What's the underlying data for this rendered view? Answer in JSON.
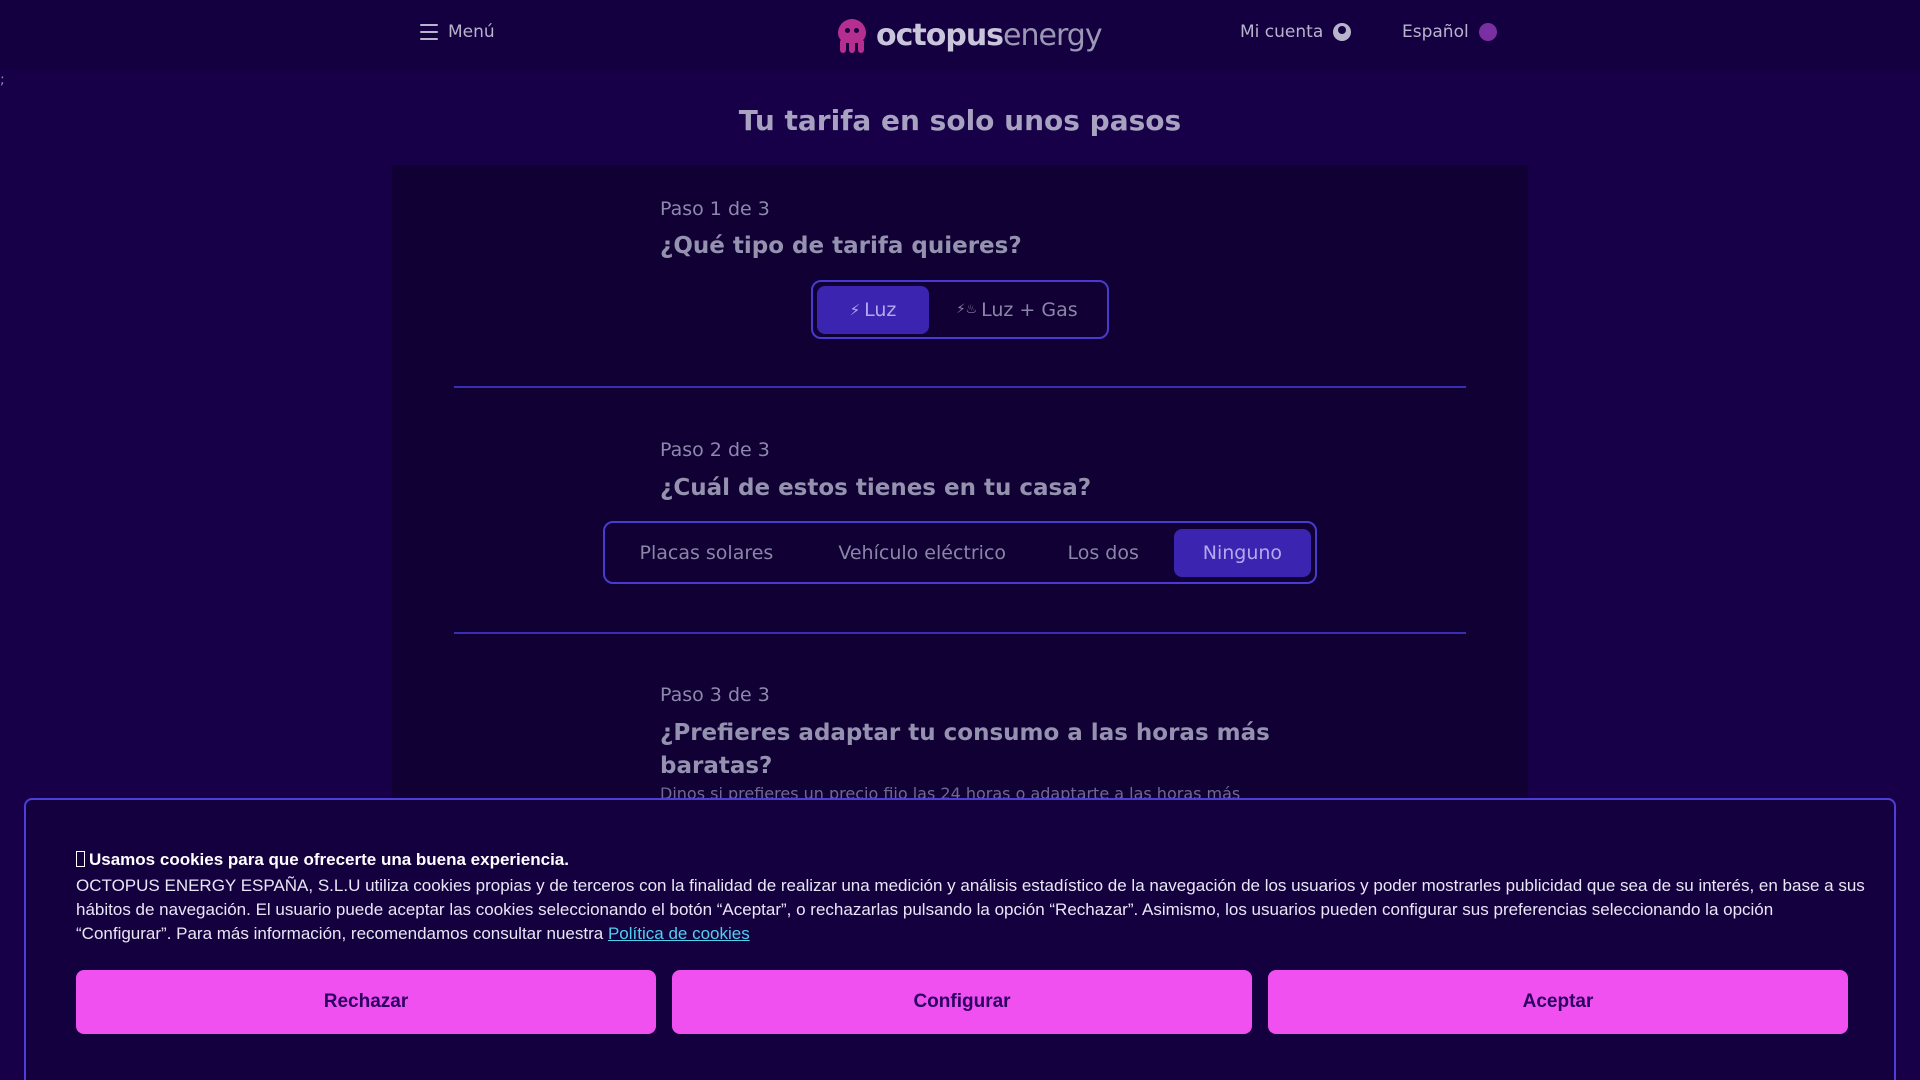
{
  "header": {
    "menu_label": "Menú",
    "logo_text_bold": "octopus",
    "logo_text_light": "energy",
    "account_label": "Mi cuenta",
    "language_label": "Español"
  },
  "stray_text": ";",
  "page": {
    "title": "Tu tarifa en solo unos pasos"
  },
  "steps": [
    {
      "label": "Paso 1 de 3",
      "question": "¿Qué tipo de tarifa quieres?",
      "options": [
        {
          "label": "Luz",
          "icon": "bolt-icon",
          "selected": true
        },
        {
          "label": "Luz + Gas",
          "icon": "bolt-flame-icon",
          "selected": false
        }
      ]
    },
    {
      "label": "Paso 2 de 3",
      "question": "¿Cuál de estos tienes en tu casa?",
      "options": [
        {
          "label": "Placas solares",
          "selected": false
        },
        {
          "label": "Vehículo eléctrico",
          "selected": false
        },
        {
          "label": "Los dos",
          "selected": false
        },
        {
          "label": "Ninguno",
          "selected": true
        }
      ]
    },
    {
      "label": "Paso 3 de 3",
      "question_line1": "¿Prefieres adaptar tu consumo a las horas más",
      "question_line2": "baratas?",
      "description": "Dinos si prefieres un precio fijo las 24 horas o adaptarte a las horas más"
    }
  ],
  "cookie_banner": {
    "heading": "Usamos cookies para que ofrecerte una buena experiencia.",
    "body": "OCTOPUS ENERGY ESPAÑA, S.L.U utiliza cookies propias y de terceros con la finalidad de realizar una medición y análisis estadístico de la navegación de los usuarios y poder mostrarles publicidad que sea de su interés, en base a sus hábitos de navegación. El usuario puede aceptar las cookies seleccionando el botón “Aceptar”, o rechazarlas pulsando la opción “Rechazar”. Asimismo, los usuarios pueden configurar sus preferencias seleccionando la opción “Configurar”. Para más información, recomendamos consultar nuestra",
    "link_text": "Política de cookies",
    "reject_label": "Rechazar",
    "configure_label": "Configurar",
    "accept_label": "Aceptar"
  },
  "colors": {
    "background": "#180048",
    "accent_pink": "#f050f0",
    "selected_option": "#3b25b0",
    "link": "#4fd0f2"
  }
}
